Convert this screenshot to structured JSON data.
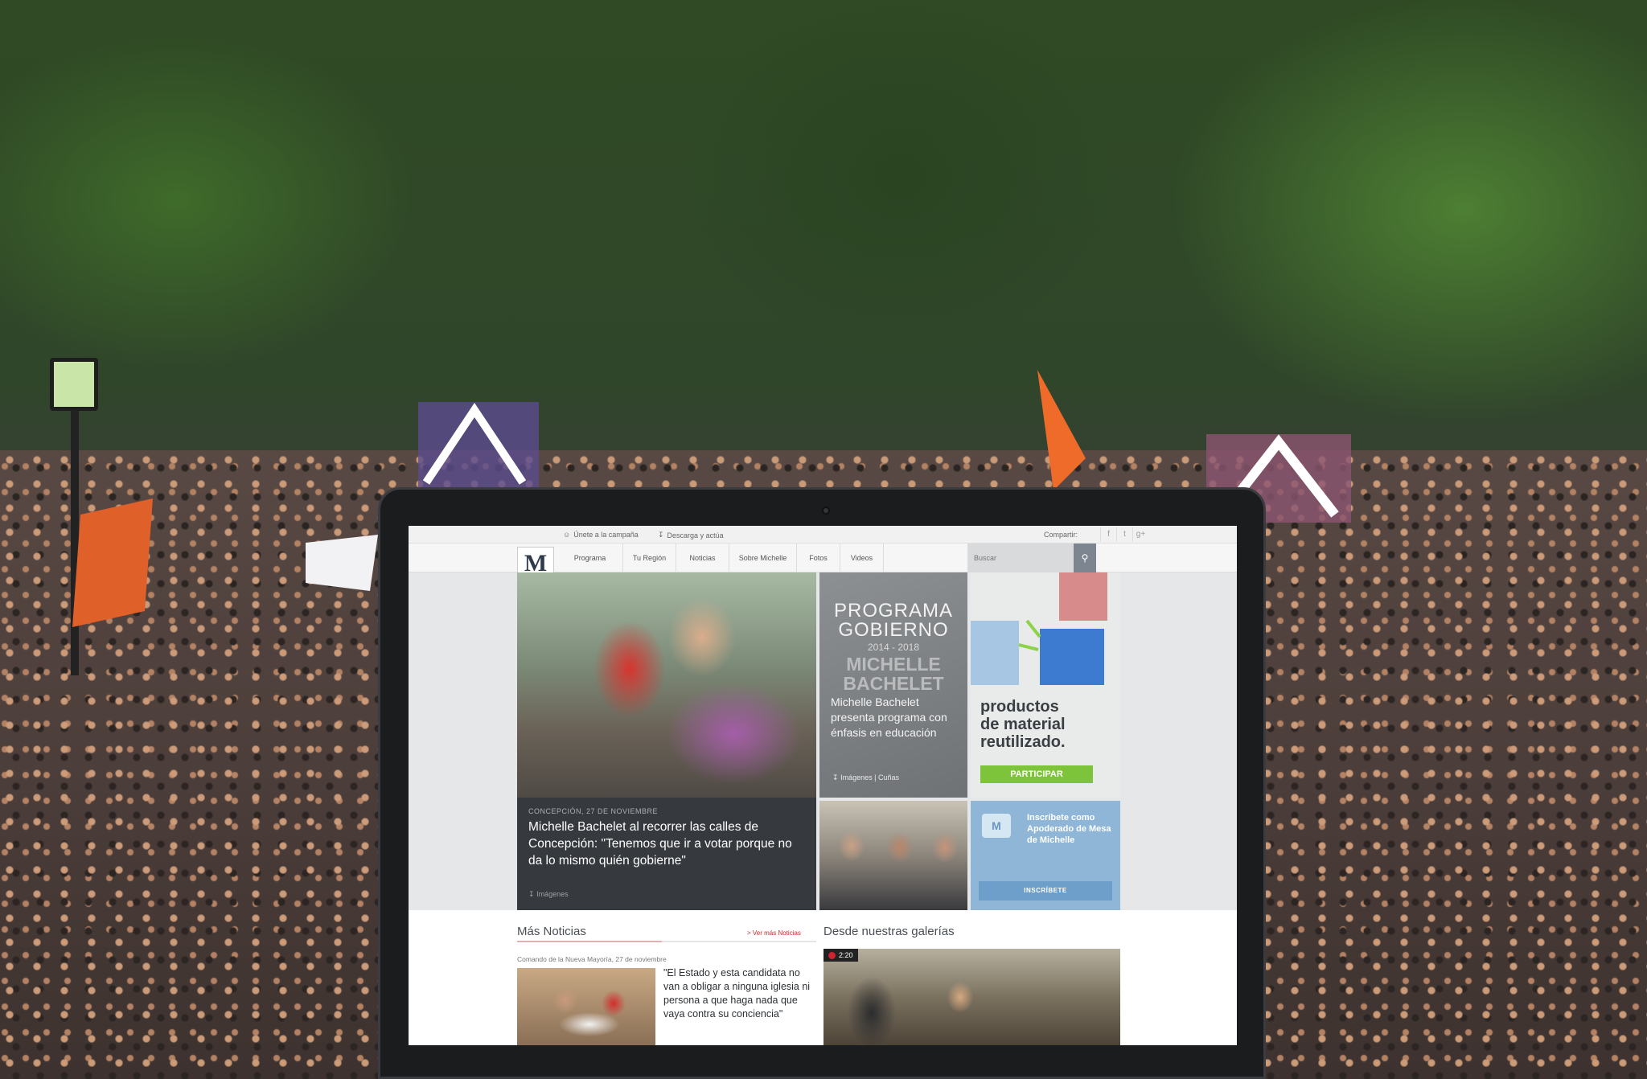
{
  "topbar": {
    "join": "Únete a la campaña",
    "download": "Descarga y actúa",
    "share": "Compartir:",
    "social": [
      "f",
      "t",
      "g+"
    ]
  },
  "nav": {
    "logo": "M",
    "items": [
      "Programa",
      "Tu Región",
      "Noticias",
      "Sobre Michelle",
      "Fotos",
      "Videos"
    ],
    "search_placeholder": "Buscar"
  },
  "hero": {
    "meta": "CONCEPCIÓN, 27 DE NOVIEMBRE",
    "title": "Michelle Bachelet al recorrer las calles de Concepción: \"Tenemos que ir a votar porque no da lo mismo quién gobierne\"",
    "media": "Imágenes"
  },
  "program": {
    "heading_line1": "PROGRAMA",
    "heading_line2": "GOBIERNO",
    "years": "2014 - 2018",
    "name_line1": "MICHELLE",
    "name_line2": "BACHELET",
    "desc": "Michelle Bachelet presenta programa con énfasis en educación",
    "media_1": "Imágenes",
    "media_2": "Cuñas"
  },
  "promo": {
    "line1": "productos",
    "line2": "de material",
    "line3": "reutilizado.",
    "button": "PARTICIPAR"
  },
  "apoderado": {
    "icon": "M",
    "text": "Inscríbete como Apoderado de Mesa de Michelle",
    "button": "INSCRÍBETE"
  },
  "news": {
    "title": "Más Noticias",
    "more": "> Ver más Noticias",
    "meta": "Comando de la Nueva Mayoría, 27 de noviembre",
    "quote": "\"El Estado y esta candidata no van a obligar a ninguna iglesia ni persona a que haga nada que vaya contra su conciencia\""
  },
  "galleries": {
    "title": "Desde nuestras galerías",
    "duration": "2:20"
  }
}
